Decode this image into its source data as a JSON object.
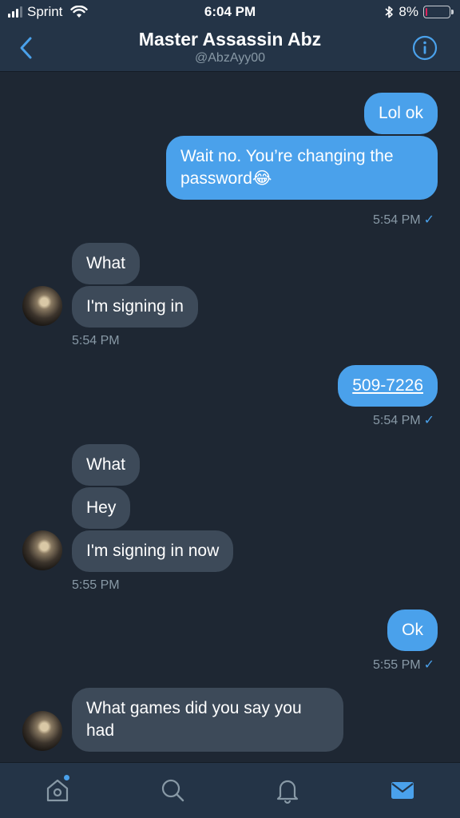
{
  "status_bar": {
    "carrier": "Sprint",
    "time": "6:04 PM",
    "battery_text": "8%",
    "battery_level": 0.08,
    "signal_bars": 3
  },
  "header": {
    "title": "Master Assassin Abz",
    "handle": "@AbzAyy00"
  },
  "messages": [
    {
      "direction": "out",
      "text": "Lol ok"
    },
    {
      "direction": "out",
      "text": "Wait no. You’re changing the password😂",
      "timestamp": "5:54 PM",
      "read_mark": "✓"
    },
    {
      "direction": "in",
      "text": "What"
    },
    {
      "direction": "in",
      "text": "I'm signing in",
      "timestamp": "5:54 PM"
    },
    {
      "direction": "out",
      "text": "509-7226",
      "link": true,
      "timestamp": "5:54 PM",
      "read_mark": "✓"
    },
    {
      "direction": "in",
      "text": "What"
    },
    {
      "direction": "in",
      "text": "Hey"
    },
    {
      "direction": "in",
      "text": "I'm signing in now",
      "timestamp": "5:55 PM"
    },
    {
      "direction": "out",
      "text": "Ok",
      "timestamp": "5:55 PM",
      "read_mark": "✓"
    },
    {
      "direction": "in",
      "text": "What games did you say you had"
    }
  ],
  "tab_bar": {
    "items": [
      "home-icon",
      "search-icon",
      "notifications-icon",
      "messages-icon"
    ],
    "active": "messages-icon",
    "accent": "#4aa1eb"
  },
  "colors": {
    "background": "#1e2733",
    "bar": "#243447",
    "outgoing_bubble": "#4aa1eb",
    "incoming_bubble": "#3d4a59",
    "muted_text": "#8899a6"
  }
}
